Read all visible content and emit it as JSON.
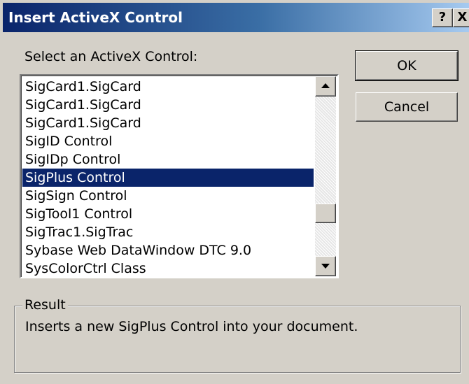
{
  "window": {
    "title": "Insert ActiveX Control",
    "help_label": "?",
    "close_label": "X"
  },
  "list": {
    "label": "Select an ActiveX Control:",
    "items": [
      "SigCard1.SigCard",
      "SigCard1.SigCard",
      "SigCard1.SigCard",
      "SigID Control",
      "SigIDp Control",
      "SigPlus Control",
      "SigSign Control",
      "SigTool1 Control",
      "SigTrac1.SigTrac",
      "Sybase Web DataWindow DTC 9.0",
      "SysColorCtrl Class"
    ],
    "selected_item": "SigPlus Control"
  },
  "buttons": {
    "ok_label": "OK",
    "cancel_label": "Cancel"
  },
  "result": {
    "label": "Result",
    "text": "Inserts a new SigPlus Control into your document."
  },
  "colors": {
    "dialog_face": "#d4d0c8",
    "title_start": "#0a246a",
    "title_end": "#a6caf0",
    "selection": "#0a246a"
  }
}
